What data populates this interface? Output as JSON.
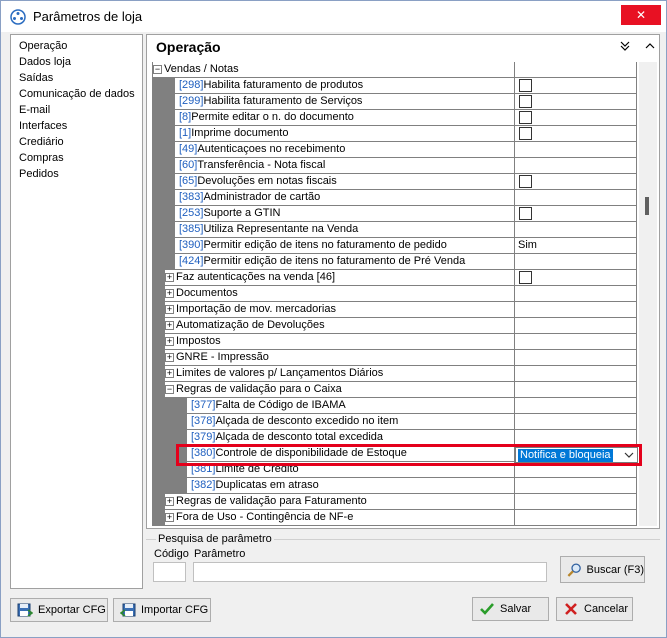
{
  "window": {
    "title": "Parâmetros de loja",
    "close_symbol": "✕"
  },
  "nav": {
    "items": [
      "Operação",
      "Dados loja",
      "Saídas",
      "Comunicação de dados",
      "E-mail",
      "Interfaces",
      "Crediário",
      "Compras",
      "Pedidos"
    ]
  },
  "panel": {
    "title": "Operação"
  },
  "grid": {
    "rows": [
      {
        "indent": 0,
        "expander": "−",
        "code": "",
        "label": "Vendas / Notas",
        "value": "",
        "checkbox": false
      },
      {
        "indent": 2,
        "expander": "",
        "code": "[298]",
        "label": "Habilita faturamento de produtos",
        "value": "",
        "checkbox": true
      },
      {
        "indent": 2,
        "expander": "",
        "code": "[299]",
        "label": "Habilita faturamento de Serviços",
        "value": "",
        "checkbox": true
      },
      {
        "indent": 2,
        "expander": "",
        "code": "[8]",
        "label": "Permite editar o n. do documento",
        "value": "",
        "checkbox": true
      },
      {
        "indent": 2,
        "expander": "",
        "code": "[1]",
        "label": "Imprime documento",
        "value": "",
        "checkbox": true
      },
      {
        "indent": 2,
        "expander": "",
        "code": "[49]",
        "label": "Autenticaçoes no recebimento",
        "value": "",
        "checkbox": false
      },
      {
        "indent": 2,
        "expander": "",
        "code": "[60]",
        "label": "Transferência - Nota fiscal",
        "value": "",
        "checkbox": false
      },
      {
        "indent": 2,
        "expander": "",
        "code": "[65]",
        "label": "Devoluções em notas fiscais",
        "value": "",
        "checkbox": true
      },
      {
        "indent": 2,
        "expander": "",
        "code": "[383]",
        "label": "Administrador de cartão",
        "value": "",
        "checkbox": false
      },
      {
        "indent": 2,
        "expander": "",
        "code": "[253]",
        "label": "Suporte a GTIN",
        "value": "",
        "checkbox": true
      },
      {
        "indent": 2,
        "expander": "",
        "code": "[385]",
        "label": "Utiliza Representante na Venda",
        "value": "",
        "checkbox": false
      },
      {
        "indent": 2,
        "expander": "",
        "code": "[390]",
        "label": "Permitir edição de itens no faturamento de pedido",
        "value": "Sim",
        "checkbox": false
      },
      {
        "indent": 2,
        "expander": "",
        "code": "[424]",
        "label": "Permitir edição de itens no faturamento de Pré Venda",
        "value": "",
        "checkbox": false
      },
      {
        "indent": 1,
        "expander": "+",
        "code": "",
        "label": "Faz autenticações na venda [46]",
        "value": "",
        "checkbox": true
      },
      {
        "indent": 1,
        "expander": "+",
        "code": "",
        "label": "Documentos",
        "value": "",
        "checkbox": false
      },
      {
        "indent": 1,
        "expander": "+",
        "code": "",
        "label": "Importação de mov. mercadorias",
        "value": "",
        "checkbox": false
      },
      {
        "indent": 1,
        "expander": "+",
        "code": "",
        "label": "Automatização de Devoluções",
        "value": "",
        "checkbox": false
      },
      {
        "indent": 1,
        "expander": "+",
        "code": "",
        "label": "Impostos",
        "value": "",
        "checkbox": false
      },
      {
        "indent": 1,
        "expander": "+",
        "code": "",
        "label": "GNRE - Impressão",
        "value": "",
        "checkbox": false
      },
      {
        "indent": 1,
        "expander": "+",
        "code": "",
        "label": "Limites de valores p/ Lançamentos Diários",
        "value": "",
        "checkbox": false
      },
      {
        "indent": 1,
        "expander": "−",
        "code": "",
        "label": "Regras de validação para o Caixa",
        "value": "",
        "checkbox": false
      },
      {
        "indent": 3,
        "expander": "",
        "code": "[377]",
        "label": "Falta de Código de IBAMA",
        "value": "",
        "checkbox": false
      },
      {
        "indent": 3,
        "expander": "",
        "code": "[378]",
        "label": "Alçada de desconto excedido no item",
        "value": "",
        "checkbox": false
      },
      {
        "indent": 3,
        "expander": "",
        "code": "[379]",
        "label": "Alçada de desconto total excedida",
        "value": "",
        "checkbox": false
      },
      {
        "indent": 3,
        "expander": "",
        "code": "[380]",
        "label": "Controle de disponibilidade de Estoque",
        "value": "",
        "checkbox": false
      },
      {
        "indent": 3,
        "expander": "",
        "code": "[381]",
        "label": "Limite de Crédito",
        "value": "",
        "checkbox": false
      },
      {
        "indent": 3,
        "expander": "",
        "code": "[382]",
        "label": "Duplicatas em atraso",
        "value": "",
        "checkbox": false
      },
      {
        "indent": 1,
        "expander": "+",
        "code": "",
        "label": "Regras de validação para Faturamento",
        "value": "",
        "checkbox": false
      },
      {
        "indent": 1,
        "expander": "+",
        "code": "",
        "label": "Fora de Uso - Contingência de NF-e",
        "value": "",
        "checkbox": false
      }
    ],
    "selected_dropdown_value": "Notifica e bloqueia"
  },
  "search": {
    "legend": "Pesquisa de parâmetro",
    "code_label": "Código",
    "param_label": "Parâmetro",
    "code_value": "",
    "param_value": "",
    "search_button": "Buscar (F3)"
  },
  "footer": {
    "export_button": "Exportar CFG",
    "import_button": "Importar CFG",
    "save_button": "Salvar",
    "cancel_button": "Cancelar"
  }
}
